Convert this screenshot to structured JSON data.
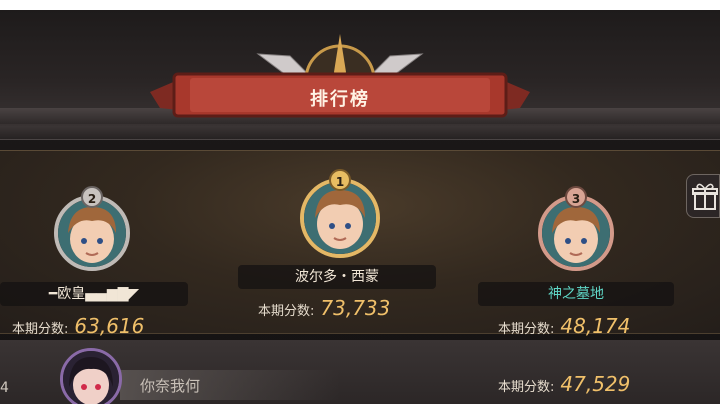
{
  "header": {
    "title": "排行榜"
  },
  "score_label": "本期分数:",
  "podium": [
    {
      "rank": "2",
      "name": "━欧皇▄▄▆▇◤",
      "score": "63,616",
      "name_color": "#f1e6d6",
      "ring": "#bfbab6"
    },
    {
      "rank": "1",
      "name": "波尔多・西蒙",
      "score": "73,733",
      "name_color": "#f1e6d6",
      "ring": "#e4b866"
    },
    {
      "rank": "3",
      "name": "神之墓地",
      "score": "48,174",
      "name_color": "#5fd6c6",
      "ring": "#d39a8a"
    }
  ],
  "row4": {
    "rank": "4",
    "name": "你奈我何",
    "score": "47,529"
  },
  "icons": {
    "gift": "gift-icon",
    "avatar": "avatar-icon"
  }
}
